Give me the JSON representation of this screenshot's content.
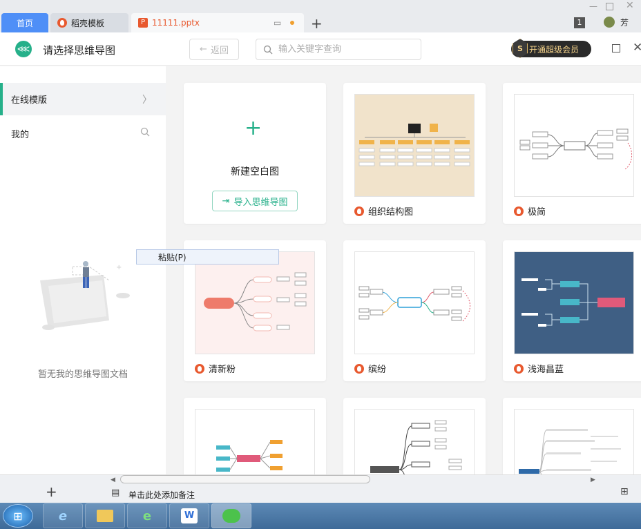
{
  "tabs": [
    {
      "label": "首页"
    },
    {
      "label": "稻壳模板"
    },
    {
      "label": "11111.pptx"
    }
  ],
  "header": {
    "title": "请选择思维导图",
    "back_label": "返回",
    "search_placeholder": "输入关键字查询",
    "vip_label": "开通超级会员",
    "vip_badge": "S"
  },
  "sidebar": {
    "online_label": "在线模版",
    "mine_label": "我的",
    "empty_text": "暂无我的思维导图文档"
  },
  "blank_card": {
    "label": "新建空白图",
    "import_label": "导入思维导图"
  },
  "templates": [
    {
      "label": "组织结构图",
      "thumb_bg": "#f1e3cb"
    },
    {
      "label": "极简",
      "thumb_bg": "#ffffff"
    },
    {
      "label": "清新粉",
      "thumb_bg": "#fdf0ef"
    },
    {
      "label": "缤纷",
      "thumb_bg": "#ffffff"
    },
    {
      "label": "浅海昌蓝",
      "thumb_bg": "#3f5f84"
    }
  ],
  "paste_menu": {
    "label": "粘贴(P)"
  },
  "bottom": {
    "notes_label": "单击此处添加备注",
    "badge_number": "1",
    "user_name": "芳"
  },
  "colors": {
    "accent": "#26b08a",
    "tab_active": "#4f8ff7",
    "flame": "#e8592f"
  }
}
